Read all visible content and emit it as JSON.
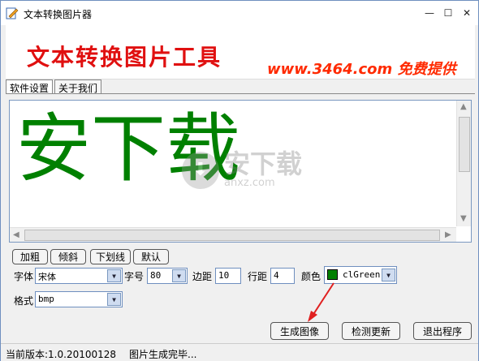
{
  "window": {
    "title": "文本转换图片器",
    "icon": "edit-icon"
  },
  "banner": {
    "title": "文本转换图片工具",
    "subtitle": "www.3464.com 免费提供"
  },
  "tabs": [
    {
      "label": "软件设置",
      "active": true
    },
    {
      "label": "关于我们",
      "active": false
    }
  ],
  "preview": {
    "text": "安下载",
    "color": "#008000"
  },
  "watermark": {
    "main": "安下载",
    "url": "anxz.com"
  },
  "style_buttons": {
    "bold": "加粗",
    "italic": "倾斜",
    "underline": "下划线",
    "default": "默认"
  },
  "form": {
    "font_label": "字体",
    "font_value": "宋体",
    "size_label": "字号",
    "size_value": "80",
    "margin_label": "边距",
    "margin_value": "10",
    "spacing_label": "行距",
    "spacing_value": "4",
    "color_label": "颜色",
    "color_value": "clGreen",
    "format_label": "格式",
    "format_value": "bmp"
  },
  "actions": {
    "generate": "生成图像",
    "update": "检测更新",
    "exit": "退出程序"
  },
  "status": {
    "version": "当前版本:1.0.20100128",
    "message": "图片生成完毕..."
  }
}
